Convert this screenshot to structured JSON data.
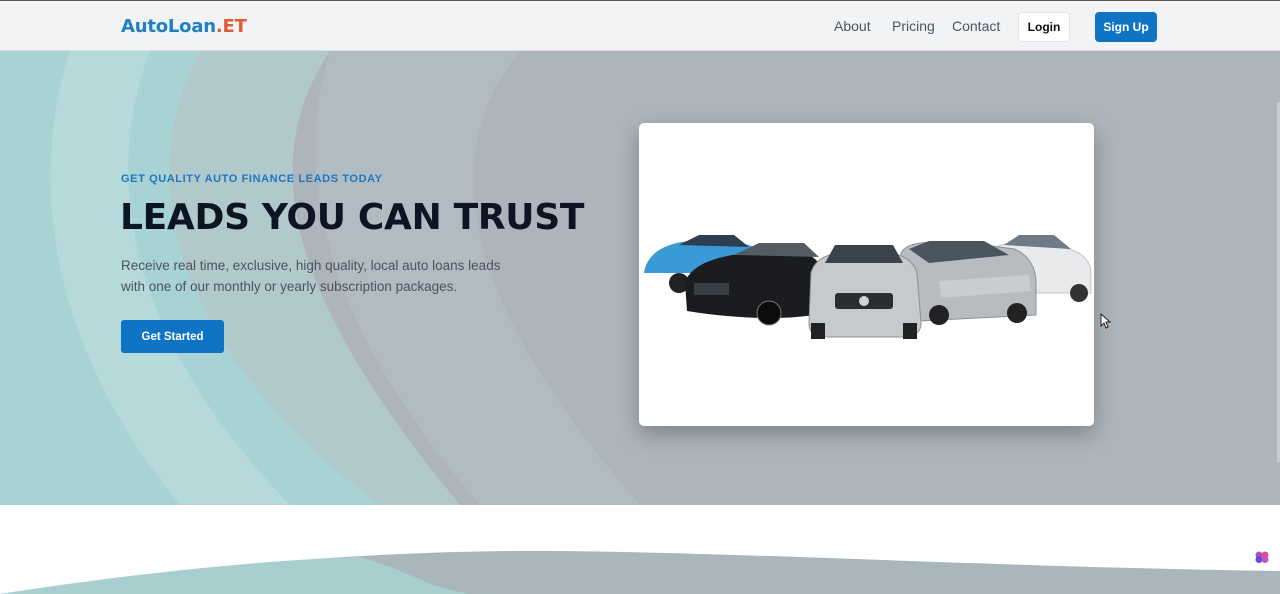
{
  "brand": {
    "name_primary": "AutoLoan",
    "name_accent": ".ET"
  },
  "nav": {
    "links": [
      "About",
      "Pricing",
      "Contact"
    ],
    "login_label": "Login",
    "signup_label": "Sign Up"
  },
  "hero": {
    "eyebrow": "GET QUALITY AUTO FINANCE LEADS TODAY",
    "headline": "LEADS YOU CAN TRUST",
    "description": "Receive real time, exclusive, high quality, local auto loans leads with one of our monthly or yearly subscription packages.",
    "cta_label": "Get Started"
  },
  "colors": {
    "primary": "#0f74c4",
    "brand_blue": "#1f7fc3",
    "brand_orange": "#e25a35",
    "hero_bg": "#aeb5bc"
  },
  "icons": {
    "cursor": "mouse-pointer-icon",
    "widget": "brain-icon"
  }
}
